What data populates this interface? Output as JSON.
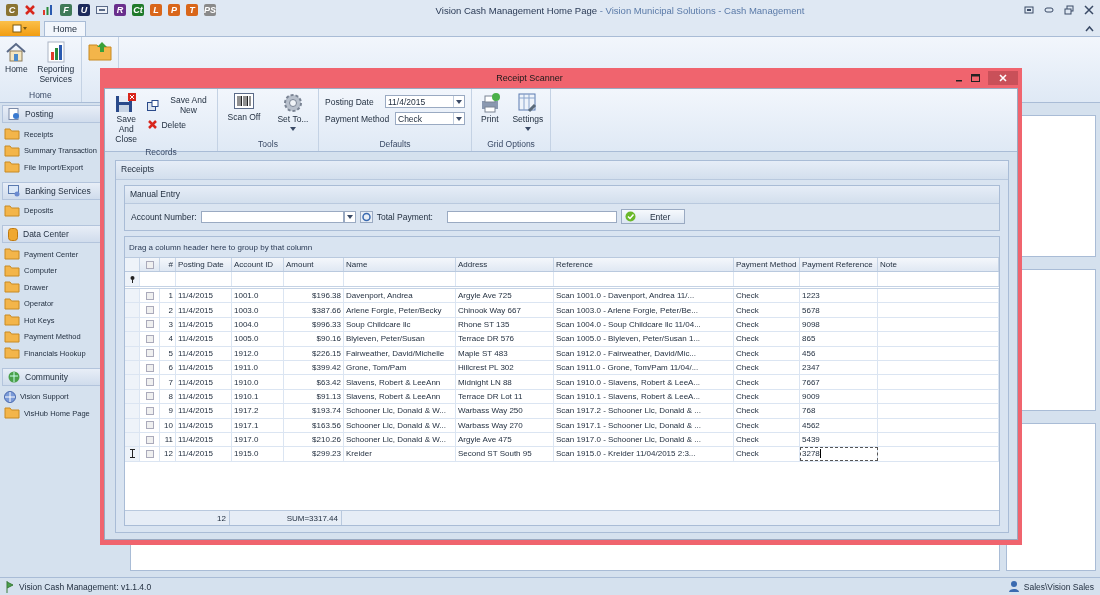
{
  "quick_access": [
    {
      "kind": "letter",
      "label": "C",
      "color": "#8a7432"
    },
    {
      "kind": "close"
    },
    {
      "kind": "chart"
    },
    {
      "kind": "letter",
      "label": "F",
      "color": "#3f7a58"
    },
    {
      "kind": "letter",
      "label": "U",
      "color": "#1c2a5c"
    },
    {
      "kind": "box"
    },
    {
      "kind": "letter",
      "label": "R",
      "color": "#6a2f8c"
    },
    {
      "kind": "letter",
      "label": "Ct",
      "color": "#1f7a2a"
    },
    {
      "kind": "letter",
      "label": "L",
      "color": "#d9661a"
    },
    {
      "kind": "letter",
      "label": "P",
      "color": "#d9661a"
    },
    {
      "kind": "letter",
      "label": "T",
      "color": "#d9661a"
    },
    {
      "kind": "letter",
      "label": "PS",
      "color": "#8a8a8a"
    }
  ],
  "window": {
    "title": "Vision Cash Management Home Page",
    "subtitle": " - Vision Municipal Solutions - Cash Management"
  },
  "ribbon_tabs": [
    {
      "label": "Home",
      "selected": true
    }
  ],
  "ribbon": {
    "groups": [
      {
        "label": "Home",
        "buttons": [
          {
            "kind": "home",
            "label": "Home"
          },
          {
            "kind": "report",
            "label": "Reporting Services"
          }
        ]
      }
    ]
  },
  "sidebar": {
    "sections": [
      {
        "title": "Posting",
        "kind": "posting",
        "items": [
          {
            "label": "Receipts",
            "kind": "folder"
          },
          {
            "label": "Summary Transaction",
            "kind": "folder"
          },
          {
            "label": "File Import/Export",
            "kind": "folder"
          }
        ]
      },
      {
        "title": "Banking Services",
        "kind": "bank",
        "items": [
          {
            "label": "Deposits",
            "kind": "folder"
          }
        ]
      },
      {
        "title": "Data Center",
        "kind": "database",
        "items": [
          {
            "label": "Payment Center",
            "kind": "folder"
          },
          {
            "label": "Computer",
            "kind": "folder"
          },
          {
            "label": "Drawer",
            "kind": "folder"
          },
          {
            "label": "Operator",
            "kind": "folder"
          },
          {
            "label": "Hot Keys",
            "kind": "folder"
          },
          {
            "label": "Payment Method",
            "kind": "folder"
          },
          {
            "label": "Financials Hookup",
            "kind": "folder"
          }
        ]
      },
      {
        "title": "Community",
        "kind": "community",
        "items": [
          {
            "label": "Vision Support",
            "kind": "globe"
          },
          {
            "label": "VisHub Home Page",
            "kind": "folder"
          }
        ]
      }
    ]
  },
  "dialog": {
    "title": "Receipt Scanner",
    "ribbon": {
      "records": {
        "label": "Records",
        "save_close": "Save And Close",
        "save_new": "Save And New",
        "delete": "Delete"
      },
      "tools": {
        "label": "Tools",
        "scan_off": "Scan Off",
        "set_to": "Set To..."
      },
      "defaults": {
        "label": "Defaults",
        "posting_date_label": "Posting Date",
        "posting_date": "11/4/2015",
        "payment_method_label": "Payment Method",
        "payment_method": "Check"
      },
      "grid_options": {
        "label": "Grid Options",
        "print": "Print",
        "settings": "Settings"
      }
    },
    "panel_title": "Receipts",
    "manual_entry": {
      "title": "Manual Entry",
      "account_label": "Account Number:",
      "total_label": "Total Payment:",
      "enter": "Enter"
    },
    "table": {
      "select_all": {
        "checked": false
      },
      "group_hint": "Drag a column header here to group by that column",
      "columns": [
        "#",
        "Posting Date",
        "Account ID",
        "Amount",
        "Name",
        "Address",
        "Reference",
        "Payment Method",
        "Payment Reference",
        "Note"
      ],
      "rows": [
        {
          "checked": false,
          "editing": false,
          "cells": [
            "1",
            "11/4/2015",
            "1001.0",
            "$196.38",
            "Davenport, Andrea",
            "Argyle Ave 725",
            "Scan 1001.0 - Davenport, Andrea 11/...",
            "Check",
            "1223"
          ]
        },
        {
          "checked": false,
          "editing": false,
          "cells": [
            "2",
            "11/4/2015",
            "1003.0",
            "$387.66",
            "Arlene Forgie, Peter/Becky",
            "Chinook Way 667",
            "Scan 1003.0 - Arlene Forgie, Peter/Be...",
            "Check",
            "5678"
          ]
        },
        {
          "checked": false,
          "editing": false,
          "cells": [
            "3",
            "11/4/2015",
            "1004.0",
            "$996.33",
            "Soup Childcare llc",
            "Rhone ST 135",
            "Scan 1004.0 - Soup Childcare llc 11/04...",
            "Check",
            "9098"
          ]
        },
        {
          "checked": false,
          "editing": false,
          "cells": [
            "4",
            "11/4/2015",
            "1005.0",
            "$90.16",
            "Blyleven, Peter/Susan",
            "Terrace DR 576",
            "Scan 1005.0 - Blyleven, Peter/Susan 1...",
            "Check",
            "865"
          ]
        },
        {
          "checked": false,
          "editing": false,
          "cells": [
            "5",
            "11/4/2015",
            "1912.0",
            "$226.15",
            "Fairweather, David/Michelle",
            "Maple ST 483",
            "Scan 1912.0 - Fairweather, David/Mic...",
            "Check",
            "456"
          ]
        },
        {
          "checked": false,
          "editing": false,
          "cells": [
            "6",
            "11/4/2015",
            "1911.0",
            "$399.42",
            "Grone, Tom/Pam",
            "Hillcrest PL 302",
            "Scan 1911.0 - Grone, Tom/Pam 11/04/...",
            "Check",
            "2347"
          ]
        },
        {
          "checked": false,
          "editing": false,
          "cells": [
            "7",
            "11/4/2015",
            "1910.0",
            "$63.42",
            "Slavens, Robert & LeeAnn",
            "Midnight LN 88",
            "Scan 1910.0 - Slavens, Robert & LeeA...",
            "Check",
            "7667"
          ]
        },
        {
          "checked": false,
          "editing": false,
          "cells": [
            "8",
            "11/4/2015",
            "1910.1",
            "$91.13",
            "Slavens, Robert & LeeAnn",
            "Terrace DR Lot 11",
            "Scan 1910.1 - Slavens, Robert & LeeA...",
            "Check",
            "9009"
          ]
        },
        {
          "checked": false,
          "editing": false,
          "cells": [
            "9",
            "11/4/2015",
            "1917.2",
            "$193.74",
            "Schooner Llc, Donald & W...",
            "Warbass Way 250",
            "Scan 1917.2 - Schooner Llc, Donald & ...",
            "Check",
            "768"
          ]
        },
        {
          "checked": false,
          "editing": false,
          "cells": [
            "10",
            "11/4/2015",
            "1917.1",
            "$163.56",
            "Schooner Llc, Donald & W...",
            "Warbass Way 270",
            "Scan 1917.1 - Schooner Llc, Donald & ...",
            "Check",
            "4562"
          ]
        },
        {
          "checked": false,
          "editing": false,
          "cells": [
            "11",
            "11/4/2015",
            "1917.0",
            "$210.26",
            "Schooner Llc, Donald & W...",
            "Argyle Ave 475",
            "Scan 1917.0 - Schooner Llc, Donald & ...",
            "Check",
            "5439"
          ]
        },
        {
          "checked": false,
          "editing": true,
          "cells": [
            "12",
            "11/4/2015",
            "1915.0",
            "$299.23",
            "Kreider",
            "Second ST South 95",
            "Scan 1915.0 - Kreider 11/04/2015 2:3...",
            "Check",
            "3278"
          ]
        }
      ],
      "footer": {
        "count": "12",
        "sum": "SUM=3317.44"
      }
    }
  },
  "status_bar": {
    "version": "Vision Cash Management: v1.1.4.0",
    "user": "Sales\\Vision Sales"
  }
}
